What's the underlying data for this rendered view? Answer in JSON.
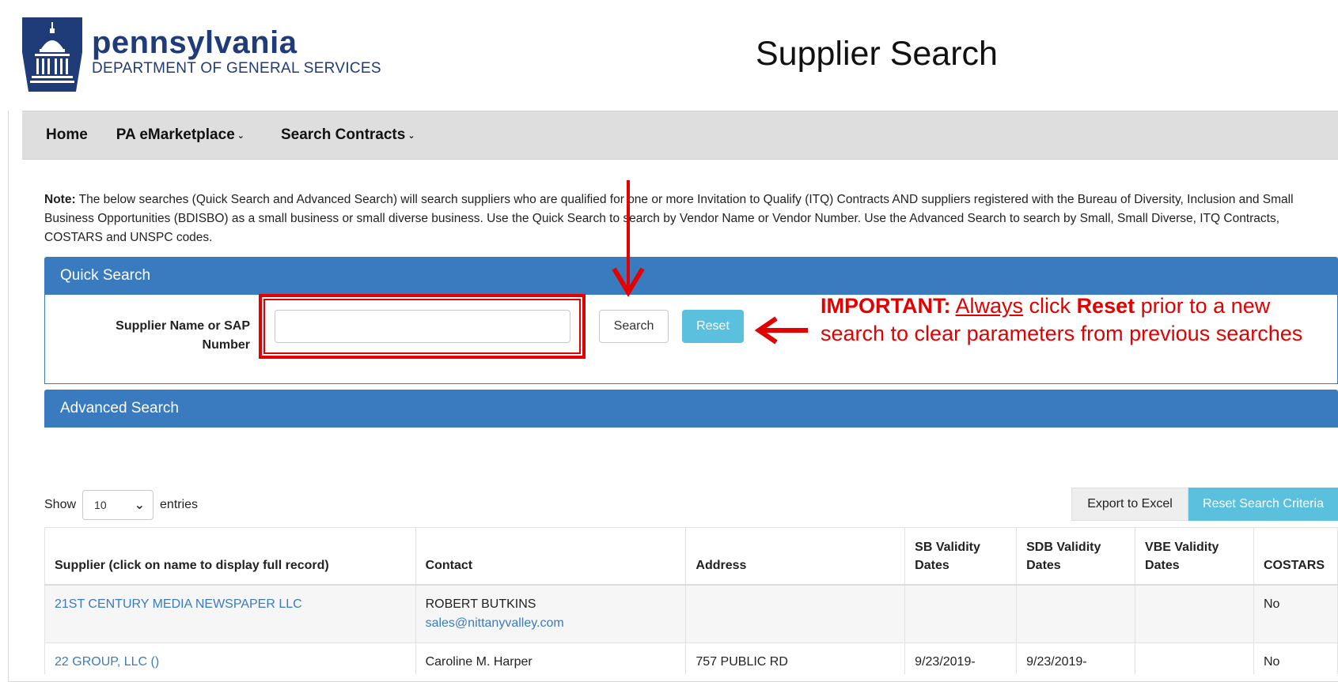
{
  "header": {
    "logo_title": "pennsylvania",
    "logo_subtitle": "DEPARTMENT OF GENERAL SERVICES",
    "page_title": "Supplier Search"
  },
  "nav": {
    "items": [
      {
        "label": "Home",
        "has_caret": false
      },
      {
        "label": "PA eMarketplace",
        "has_caret": true
      },
      {
        "label": "Search Contracts",
        "has_caret": true
      }
    ],
    "caret": "⌄"
  },
  "note": {
    "label": "Note:",
    "text": "The below searches (Quick Search and Advanced Search) will search suppliers who are qualified for one or more Invitation to Qualify (ITQ) Contracts AND suppliers registered with the Bureau of Diversity, Inclusion and Small Business Opportunities (BDISBO) as a small business or small diverse business. Use the Quick Search to search by Vendor Name or Vendor Number. Use the Advanced Search to search by Small, Small Diverse, ITQ Contracts, COSTARS and UNSPC codes."
  },
  "quick_search": {
    "title": "Quick Search",
    "field_label": "Supplier Name or SAP Number",
    "input_value": "",
    "search_label": "Search",
    "reset_label": "Reset"
  },
  "advanced_search": {
    "title": "Advanced Search"
  },
  "annotation": {
    "important": "IMPORTANT:",
    "always": "Always",
    "click": "click",
    "reset": "Reset",
    "rest": "prior to a new search to clear parameters from previous searches",
    "color": "#e30000"
  },
  "entries": {
    "show": "Show",
    "value": "10",
    "suffix": "entries"
  },
  "toolbar": {
    "export_label": "Export to Excel",
    "reset_criteria_label": "Reset Search Criteria"
  },
  "table": {
    "headers": [
      "Supplier (click on name to display full record)",
      "Contact",
      "Address",
      "SB Validity Dates",
      "SDB Validity Dates",
      "VBE Validity Dates",
      "COSTARS"
    ],
    "rows": [
      {
        "supplier": "21ST CENTURY MEDIA NEWSPAPER LLC",
        "contact_name": "ROBERT BUTKINS",
        "contact_email": "sales@nittanyvalley.com",
        "address": "",
        "sb": "",
        "sdb": "",
        "vbe": "",
        "costars": "No"
      },
      {
        "supplier": "22 GROUP, LLC ()",
        "contact_name": "Caroline M. Harper",
        "contact_email": "",
        "address": "757 PUBLIC RD",
        "sb": "9/23/2019-",
        "sdb": "9/23/2019-",
        "vbe": "",
        "costars": "No"
      }
    ]
  },
  "colors": {
    "brand_blue": "#1f3b78",
    "panel_blue": "#3a7bc0",
    "info_button": "#5bc0de",
    "annotation_red": "#e30000"
  }
}
